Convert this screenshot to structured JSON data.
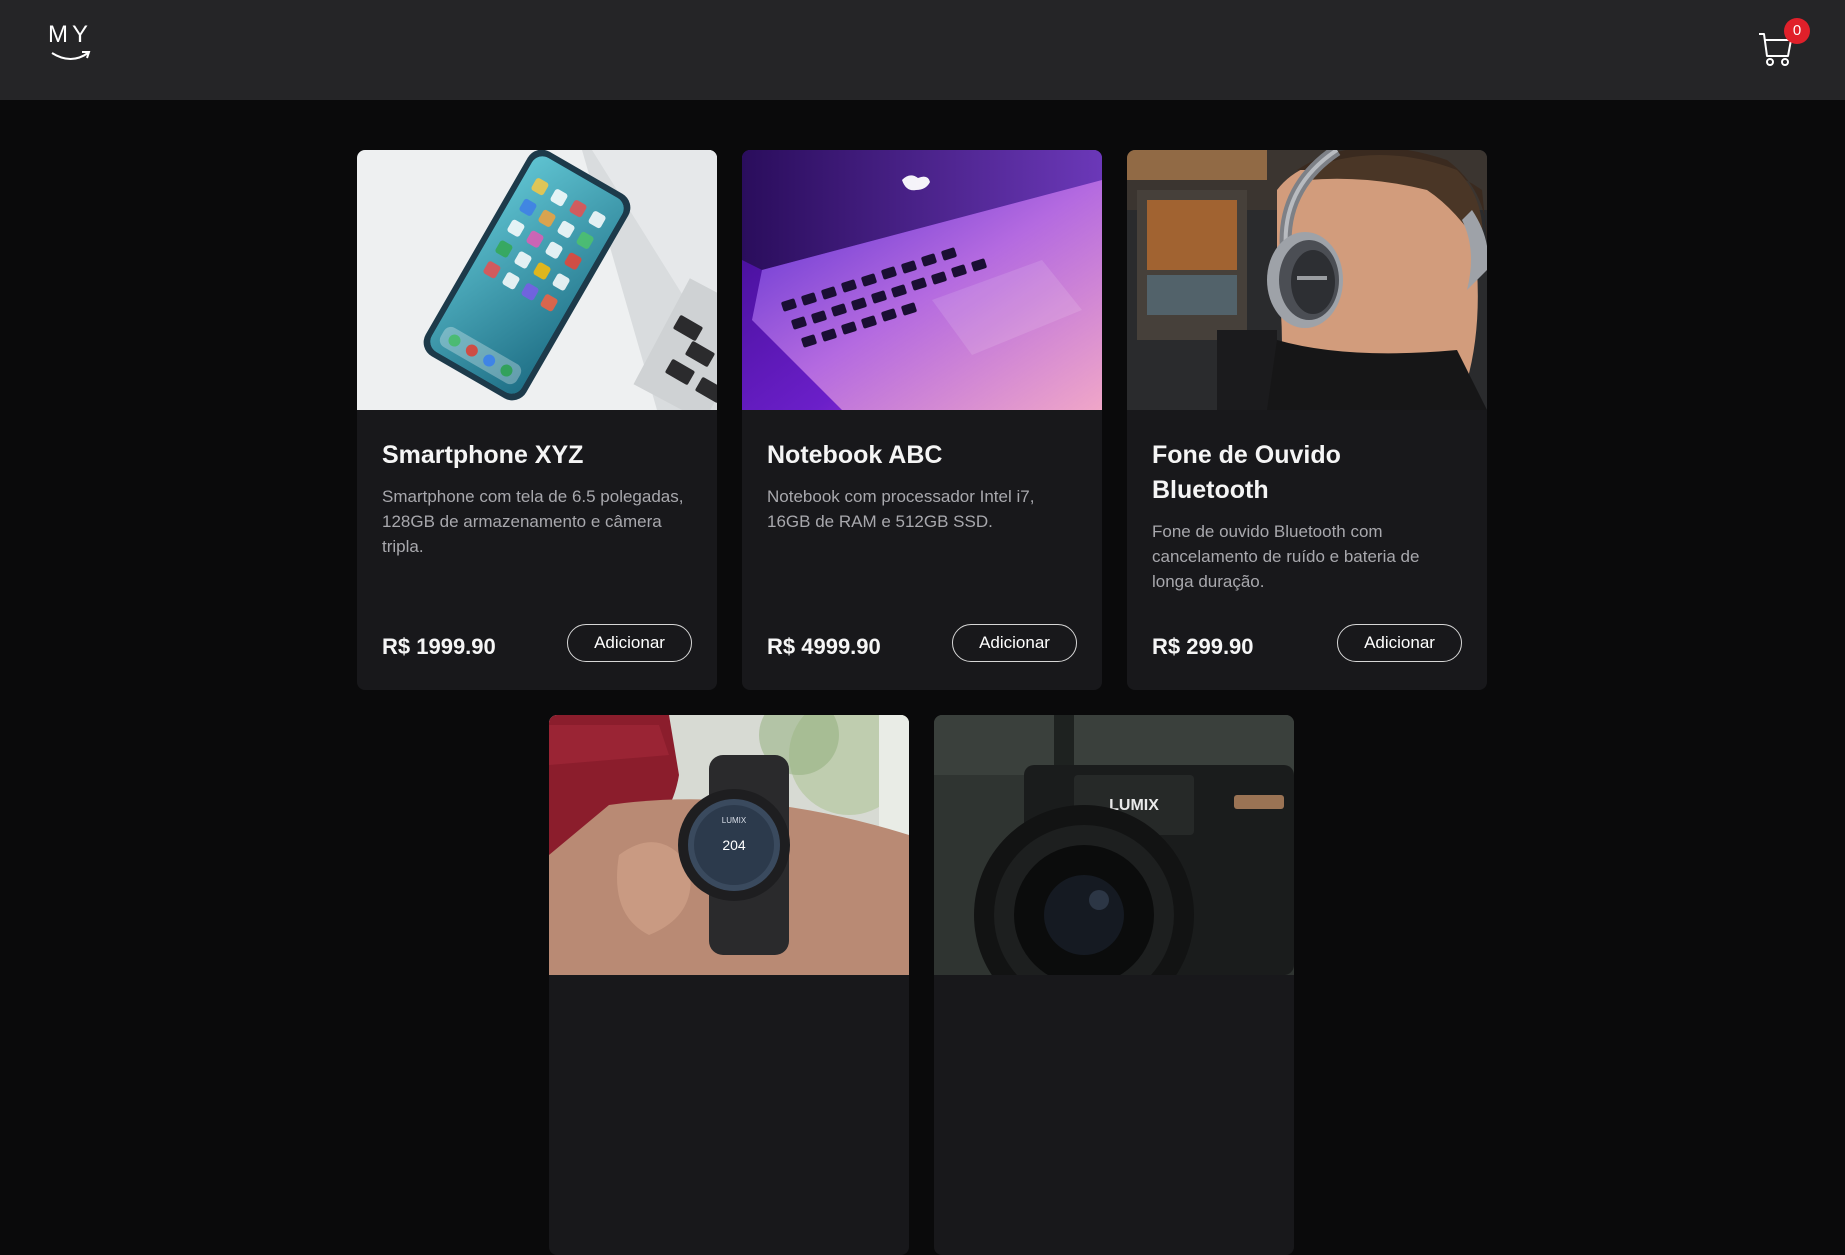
{
  "header": {
    "logo_text": "MY",
    "cart_icon": "shopping-cart-icon",
    "cart_count": "0"
  },
  "colors": {
    "header_bg": "#252527",
    "page_bg": "#0a0a0b",
    "card_bg": "#18181b",
    "badge": "#e0202a"
  },
  "products": [
    {
      "title": "Smartphone XYZ",
      "description": "Smartphone com tela de 6.5 polegadas, 128GB de armazenamento e câmera tripla.",
      "price": "R$ 1999.90",
      "button": "Adicionar",
      "image": "smartphone-photo"
    },
    {
      "title": "Notebook ABC",
      "description": "Notebook com processador Intel i7, 16GB de RAM e 512GB SSD.",
      "price": "R$ 4999.90",
      "button": "Adicionar",
      "image": "laptop-photo"
    },
    {
      "title": "Fone de Ouvido Bluetooth",
      "description": "Fone de ouvido Bluetooth com cancelamento de ruído e bateria de longa duração.",
      "price": "R$ 299.90",
      "button": "Adicionar",
      "image": "headphones-photo"
    },
    {
      "image": "smartwatch-photo",
      "watch_face_brand": "LUMIX",
      "watch_face_value": "204"
    },
    {
      "image": "camera-photo",
      "camera_brand": "LUMIX"
    }
  ]
}
